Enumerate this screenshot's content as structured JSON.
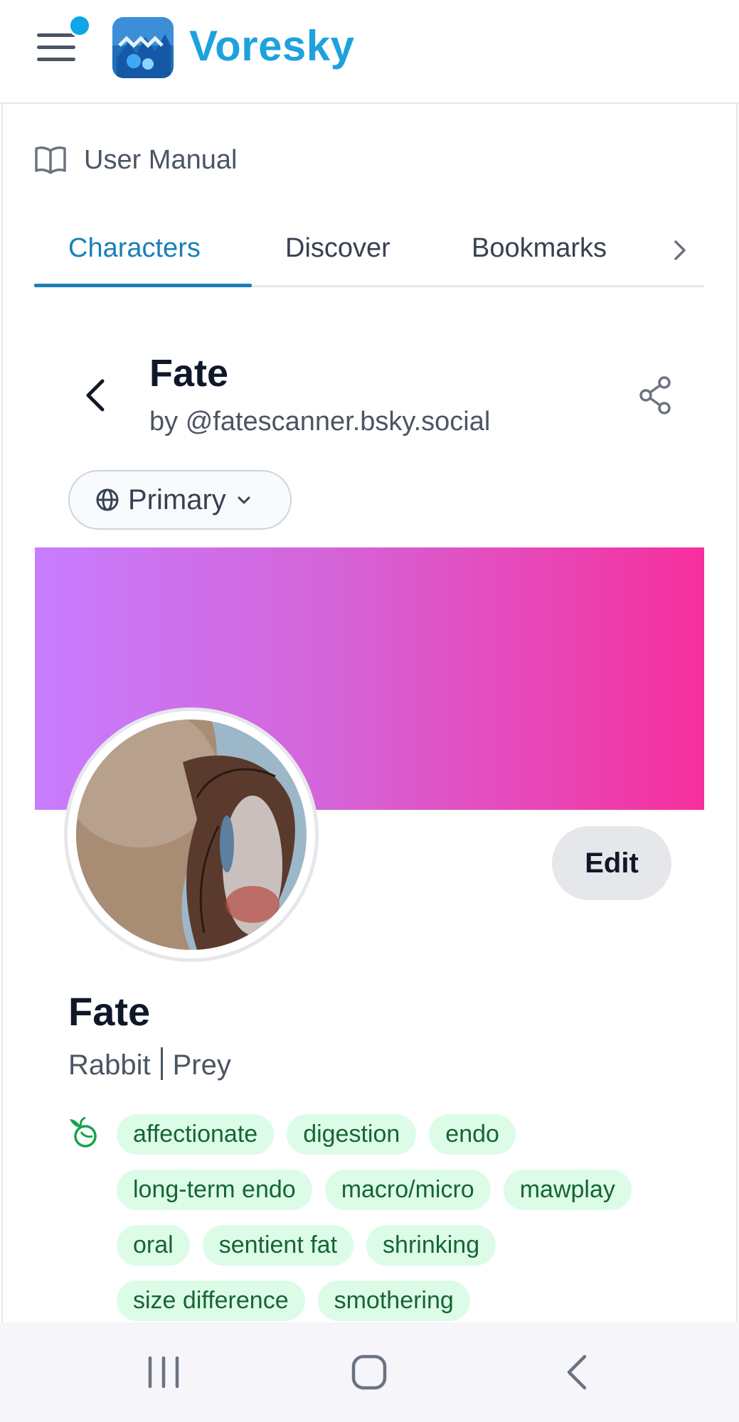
{
  "app": {
    "brand": "Voresky"
  },
  "manual": {
    "label": "User Manual"
  },
  "tabs": [
    {
      "label": "Characters",
      "active": true
    },
    {
      "label": "Discover",
      "active": false
    },
    {
      "label": "Bookmarks",
      "active": false
    }
  ],
  "character": {
    "title": "Fate",
    "owner": "by @fatescanner.bsky.social",
    "version_selector": "Primary",
    "edit_label": "Edit",
    "name": "Fate",
    "species": "Rabbit",
    "role": "Prey",
    "tags": [
      "affectionate",
      "digestion",
      "endo",
      "long-term endo",
      "macro/micro",
      "mawplay",
      "oral",
      "sentient fat",
      "shrinking",
      "size difference",
      "smothering"
    ]
  },
  "colors": {
    "brand": "#1ea2dd",
    "accent": "#1b7fb8",
    "banner_start": "#c77dff",
    "banner_end": "#f72f9d",
    "tag_bg": "#dcfce7",
    "tag_text": "#166534"
  },
  "icons": {
    "menu": "hamburger-menu-icon",
    "manual": "open-book-icon",
    "tabs_next": "chevron-right-icon",
    "back": "chevron-left-icon",
    "share": "share-icon",
    "version": "globe-icon",
    "version_caret": "chevron-down-icon",
    "tags": "leaf-swirl-icon"
  }
}
